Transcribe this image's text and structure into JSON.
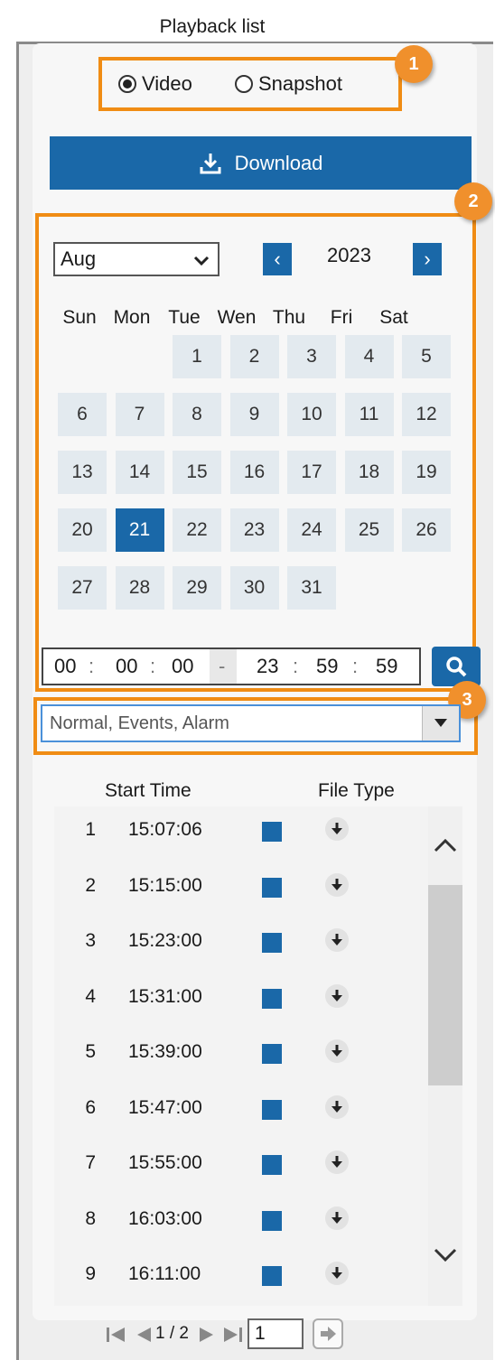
{
  "title": "Playback list",
  "media_type": {
    "options": [
      "Video",
      "Snapshot"
    ],
    "selected": "Video"
  },
  "download_label": "Download",
  "badges": [
    "1",
    "2",
    "3"
  ],
  "calendar": {
    "month": "Aug",
    "year": "2023",
    "weekdays": [
      "Sun",
      "Mon",
      "Tue",
      "Wen",
      "Thu",
      "Fri",
      "Sat"
    ],
    "days": [
      "1",
      "2",
      "3",
      "4",
      "5",
      "6",
      "7",
      "8",
      "9",
      "10",
      "11",
      "12",
      "13",
      "14",
      "15",
      "16",
      "17",
      "18",
      "19",
      "20",
      "21",
      "22",
      "23",
      "24",
      "25",
      "26",
      "27",
      "28",
      "29",
      "30",
      "31"
    ],
    "selected_day": "21",
    "first_weekday": 2
  },
  "time_range": {
    "start": [
      "00",
      "00",
      "00"
    ],
    "end": [
      "23",
      "59",
      "59"
    ],
    "sep": ":",
    "dash": "-"
  },
  "filter": {
    "value": "Normal, Events, Alarm"
  },
  "list": {
    "headers": {
      "start_time": "Start Time",
      "file_type": "File Type"
    },
    "rows": [
      {
        "num": "1",
        "time": "15:07:06"
      },
      {
        "num": "2",
        "time": "15:15:00"
      },
      {
        "num": "3",
        "time": "15:23:00"
      },
      {
        "num": "4",
        "time": "15:31:00"
      },
      {
        "num": "5",
        "time": "15:39:00"
      },
      {
        "num": "6",
        "time": "15:47:00"
      },
      {
        "num": "7",
        "time": "15:55:00"
      },
      {
        "num": "8",
        "time": "16:03:00"
      },
      {
        "num": "9",
        "time": "16:11:00"
      }
    ]
  },
  "pager": {
    "page_text": "1 / 2",
    "page_input": "1"
  },
  "colors": {
    "accent": "#1a68a8",
    "highlight": "#f08c14",
    "day_bg": "#e3eaef"
  }
}
